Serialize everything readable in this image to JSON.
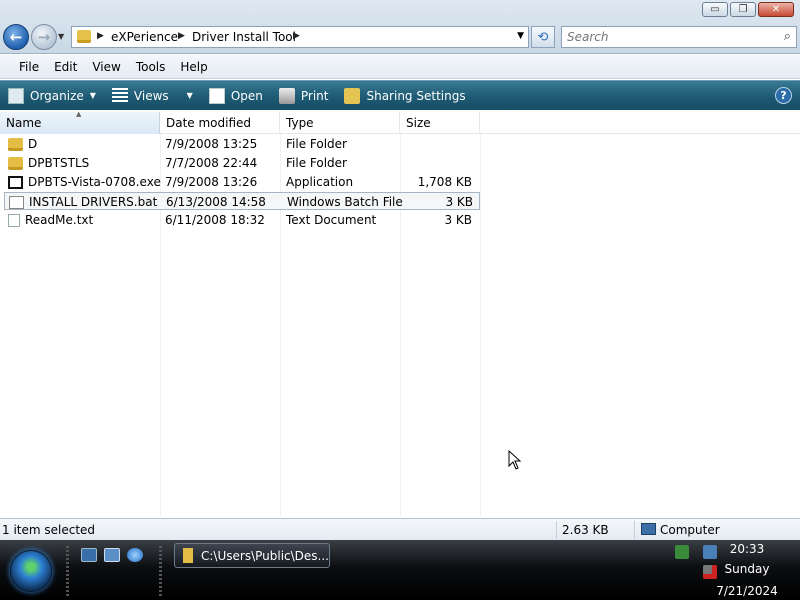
{
  "window": {
    "controls": {
      "minimize": "▭",
      "maximize": "❐",
      "close": "✕"
    }
  },
  "nav": {
    "back_icon": "←",
    "forward_icon": "→",
    "dropdown_icon": "▼"
  },
  "address": {
    "crumbs": [
      "eXPerience",
      "Driver Install Tool"
    ],
    "separator": "▶",
    "dropdown_icon": "▼",
    "refresh_icon": "⟲"
  },
  "search": {
    "placeholder": "Search",
    "icon": "search-icon"
  },
  "menu": {
    "items": [
      "File",
      "Edit",
      "View",
      "Tools",
      "Help"
    ]
  },
  "toolbar": {
    "organize": "Organize",
    "views": "Views",
    "open": "Open",
    "print": "Print",
    "sharing": "Sharing Settings",
    "help": "?",
    "caret": "▼"
  },
  "columns": {
    "name": "Name",
    "date": "Date modified",
    "type": "Type",
    "size": "Size",
    "sort_indicator": "▲"
  },
  "files": [
    {
      "name": "D",
      "date": "7/9/2008 13:25",
      "type": "File Folder",
      "size": "",
      "icon": "folder-icon",
      "selected": false
    },
    {
      "name": "DPBTSTLS",
      "date": "7/7/2008 22:44",
      "type": "File Folder",
      "size": "",
      "icon": "folder-icon",
      "selected": false
    },
    {
      "name": "DPBTS-Vista-0708.exe",
      "date": "7/9/2008 13:26",
      "type": "Application",
      "size": "1,708 KB",
      "icon": "7z-archive-icon",
      "selected": false
    },
    {
      "name": "INSTALL DRIVERS.bat",
      "date": "6/13/2008 14:58",
      "type": "Windows Batch File",
      "size": "3 KB",
      "icon": "batch-file-icon",
      "selected": true
    },
    {
      "name": "ReadMe.txt",
      "date": "6/11/2008 18:32",
      "type": "Text Document",
      "size": "3 KB",
      "icon": "text-file-icon",
      "selected": false
    }
  ],
  "status": {
    "selection": "1 item selected",
    "size": "2.63 KB",
    "location": "Computer"
  },
  "taskbar": {
    "task_label": "C:\\Users\\Public\\Des...",
    "time": "20:33",
    "day": "Sunday",
    "date": "7/21/2024"
  }
}
